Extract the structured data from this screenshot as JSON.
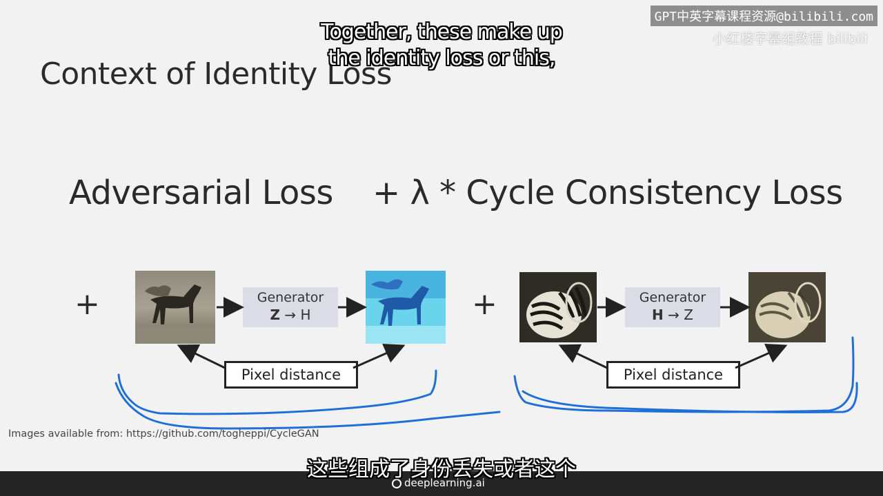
{
  "slide": {
    "title": "Context of Identity Loss",
    "equation": {
      "adversarial": "Adversarial Loss",
      "cycle": "+  λ  * Cycle Consistency Loss"
    },
    "plus": "+",
    "left_block": {
      "generator_label": "Generator",
      "generator_from": "Z",
      "generator_arrow": "→",
      "generator_to": "H",
      "pixel_distance": "Pixel distance"
    },
    "right_block": {
      "generator_label": "Generator",
      "generator_from": "H",
      "generator_arrow": "→",
      "generator_to": "Z",
      "pixel_distance": "Pixel distance"
    },
    "footnote": "Images available from: https://github.com/togheppi/CycleGAN"
  },
  "subtitles": {
    "english_line1": "Together, these make up",
    "english_line2": "the identity loss or this,",
    "chinese": "这些组成了身份丢失或者这个"
  },
  "watermark": {
    "line1": "GPT中英字幕课程资源@bilibili.com",
    "line2": "小红楼字幕组教程 bilibili"
  },
  "branding": {
    "logo_text": "deeplearning.ai"
  },
  "colors": {
    "annotation_stroke": "#1f6fd6",
    "generator_box": "#dcdce6",
    "bottom_bar": "#252525"
  }
}
